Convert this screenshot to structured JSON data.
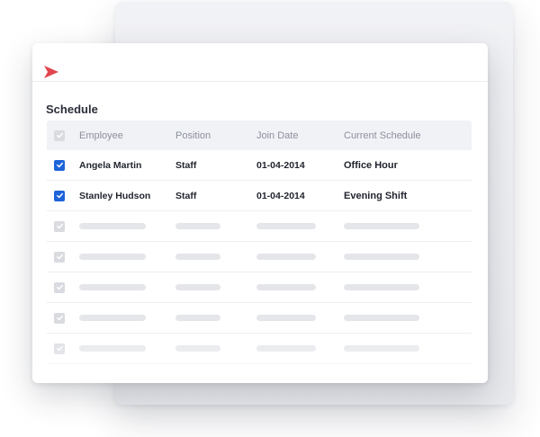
{
  "title": "Schedule",
  "colors": {
    "brand": "#e0464e",
    "checkbox": "#1e63d8"
  },
  "table": {
    "headers": {
      "employee": "Employee",
      "position": "Position",
      "join_date": "Join Date",
      "schedule": "Current Schedule"
    },
    "rows": [
      {
        "employee": "Angela Martin",
        "position": "Staff",
        "join_date": "01-04-2014",
        "schedule": "Office Hour"
      },
      {
        "employee": "Stanley Hudson",
        "position": "Staff",
        "join_date": "01-04-2014",
        "schedule": "Evening Shift"
      }
    ]
  }
}
